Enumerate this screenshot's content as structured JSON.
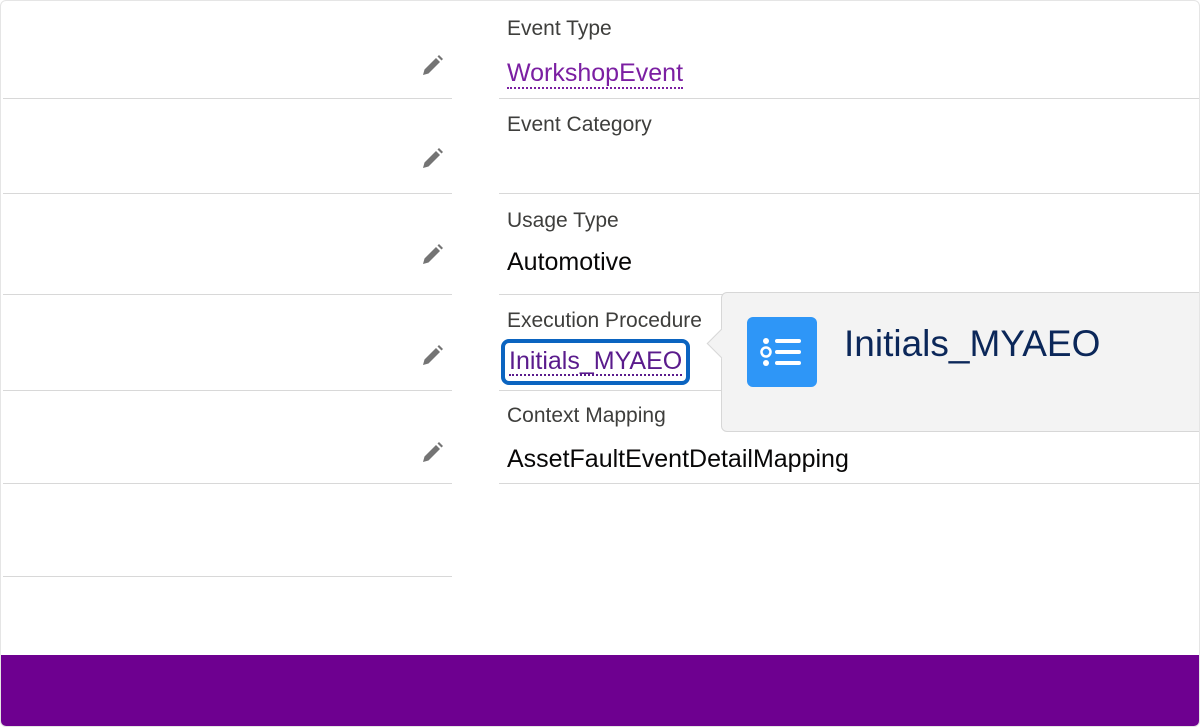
{
  "fields": {
    "event_type": {
      "label": "Event Type",
      "value": "WorkshopEvent"
    },
    "event_category": {
      "label": "Event Category",
      "value": ""
    },
    "usage_type": {
      "label": "Usage Type",
      "value": "Automotive"
    },
    "execution_procedure": {
      "label": "Execution Procedure",
      "value": "Initials_MYAEO"
    },
    "context_mapping": {
      "label": "Context Mapping",
      "value": "AssetFaultEventDetailMapping"
    }
  },
  "hovercard": {
    "title": "Initials_MYAEO",
    "icon": "list-icon",
    "icon_color": "#2e96f7"
  },
  "colors": {
    "link": "#7b1fa2",
    "focus_ring": "#0b64c0",
    "footer": "#6e0090"
  },
  "icons": {
    "edit": "pencil-icon"
  }
}
